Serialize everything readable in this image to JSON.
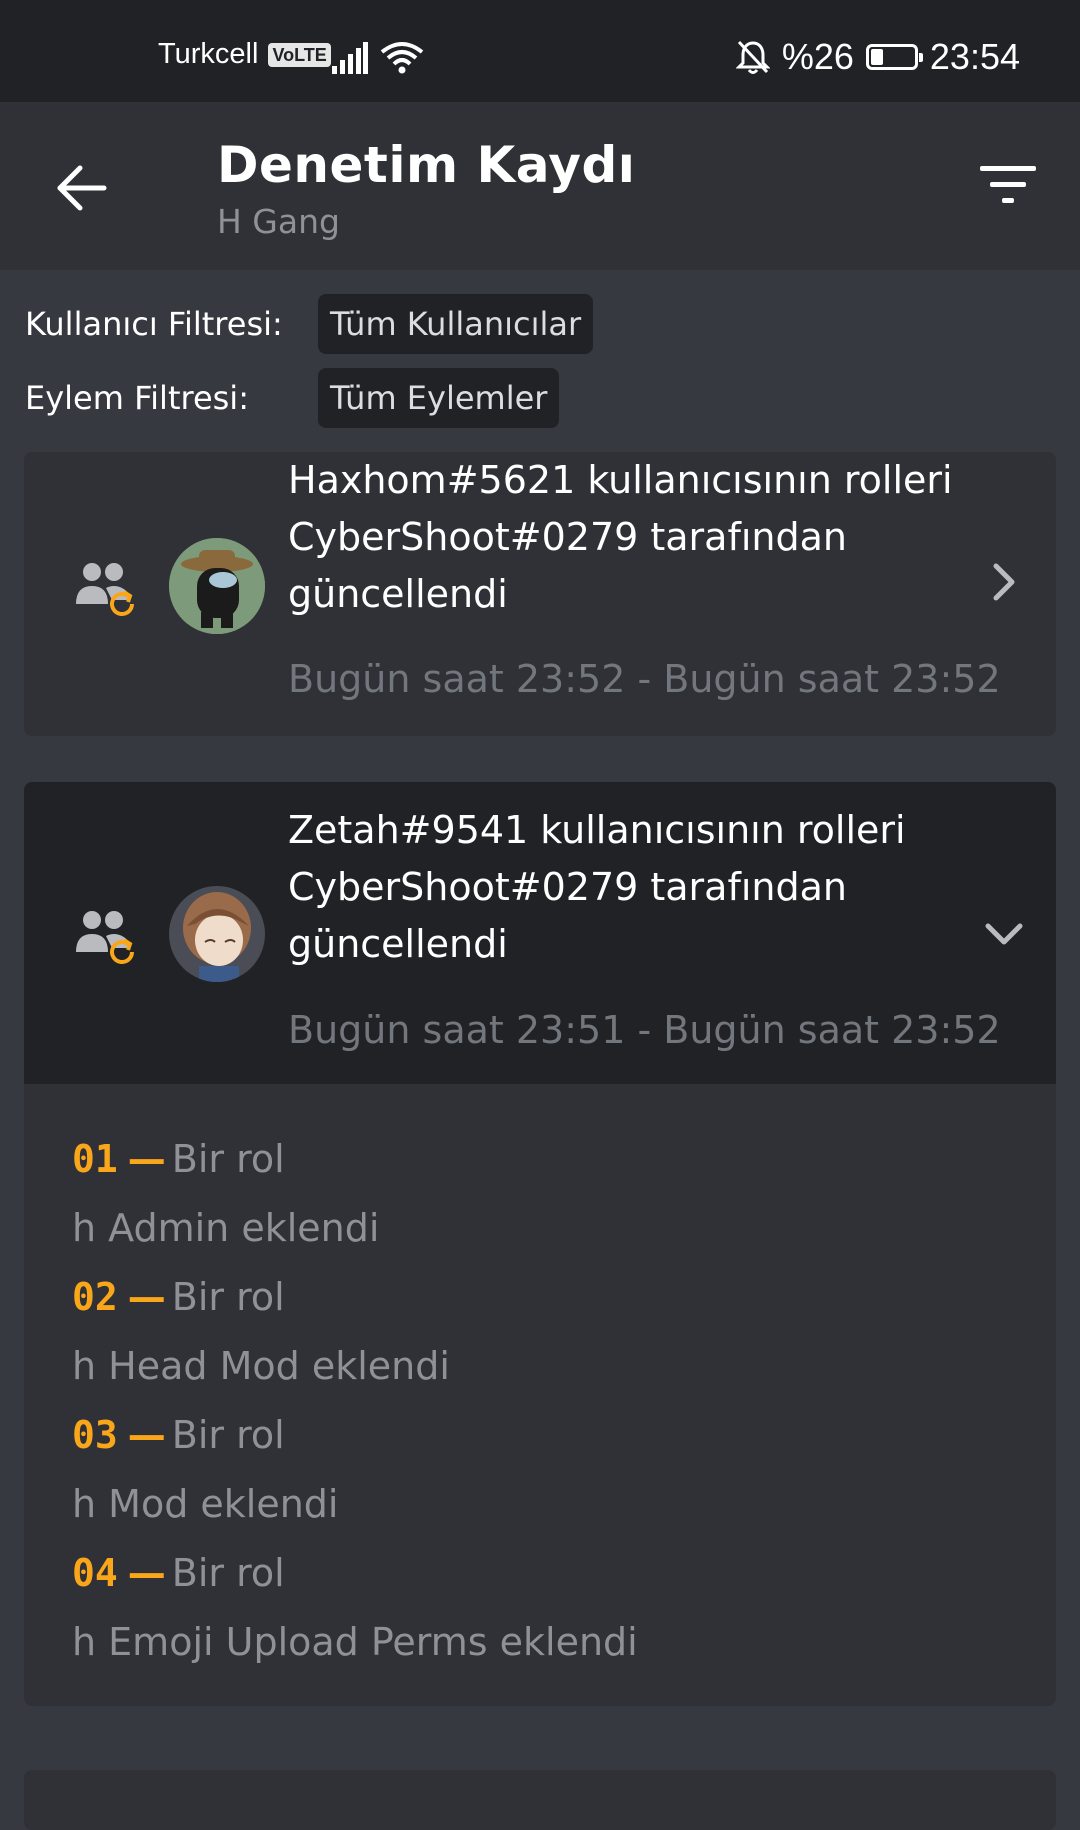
{
  "status_bar": {
    "carrier": "Turkcell",
    "volte": "VoLTE",
    "battery_text": "%26",
    "battery_level": 0.26,
    "time": "23:54",
    "icons": [
      "signal-icon",
      "wifi-icon",
      "bell-off-icon",
      "battery-icon"
    ]
  },
  "header": {
    "title": "Denetim Kaydı",
    "subtitle": "H Gang",
    "icons": [
      "back-arrow-icon",
      "filter-icon"
    ]
  },
  "filters": {
    "user_label": "Kullanıcı Filtresi:",
    "user_value": "Tüm Kullanıcılar",
    "action_label": "Eylem Filtresi:",
    "action_value": "Tüm Eylemler"
  },
  "entries": [
    {
      "title_line1": "Haxhom#5621 kullanıcısının rolleri",
      "title_line2": "CyberShoot#0279 tarafından",
      "title_line3": "güncellendi",
      "time": "Bugün saat 23:52 - Bugün saat 23:52",
      "expanded": false,
      "icon": "member-role-update-icon"
    },
    {
      "title_line1": "Zetah#9541 kullanıcısının rolleri",
      "title_line2": "CyberShoot#0279 tarafından",
      "title_line3": "güncellendi",
      "time": "Bugün saat 23:51 - Bugün saat 23:52",
      "expanded": true,
      "icon": "member-role-update-icon",
      "changes": [
        {
          "num": "01",
          "dash": "—",
          "head": "Bir rol",
          "body": "h Admin eklendi"
        },
        {
          "num": "02",
          "dash": "—",
          "head": "Bir rol",
          "body": "h Head Mod eklendi"
        },
        {
          "num": "03",
          "dash": "—",
          "head": "Bir rol",
          "body": "h Mod eklendi"
        },
        {
          "num": "04",
          "dash": "—",
          "head": "Bir rol",
          "body": "h Emoji Upload Perms eklendi"
        }
      ]
    }
  ],
  "colors": {
    "background": "#36393f",
    "header": "#2f3136",
    "status_bar": "#202225",
    "accent_orange": "#faa61a",
    "muted_text": "#8e9297"
  }
}
